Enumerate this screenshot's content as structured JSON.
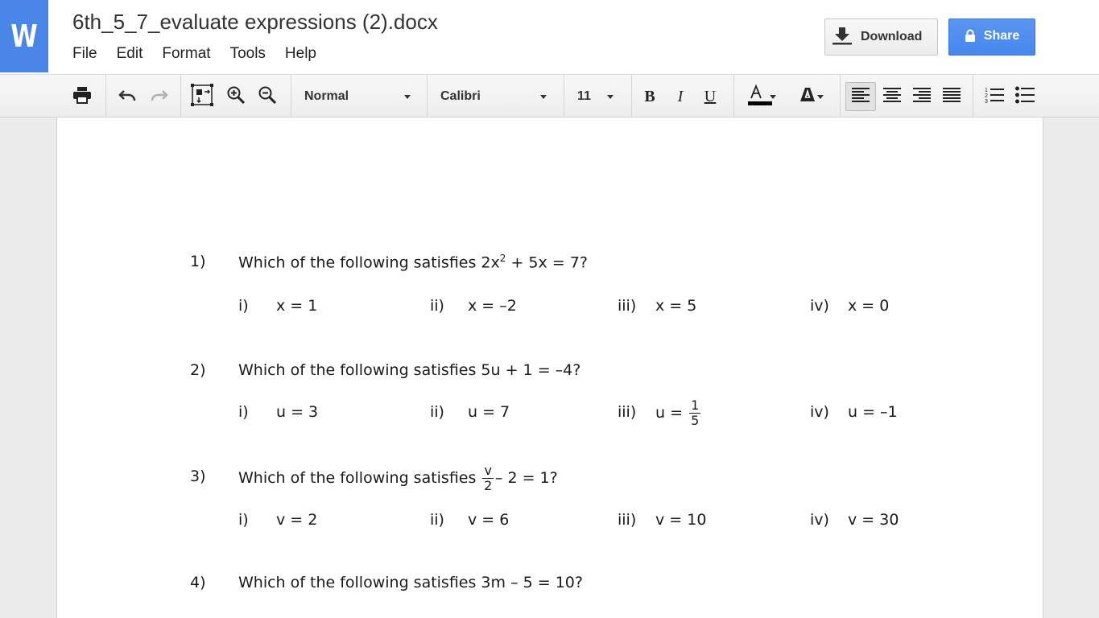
{
  "app": {
    "logo": "W",
    "title": "6th_5_7_evaluate expressions (2).docx"
  },
  "menu": [
    "File",
    "Edit",
    "Format",
    "Tools",
    "Help"
  ],
  "buttons": {
    "download": "Download",
    "share": "Share"
  },
  "toolbar": {
    "style": "Normal",
    "font": "Calibri",
    "size": "11"
  },
  "colors": {
    "brand": "#4a86e8",
    "share": "#4787ed"
  },
  "icons": [
    "print-icon",
    "undo-icon",
    "redo-icon",
    "fit-page-icon",
    "zoom-in-icon",
    "zoom-out-icon",
    "bold-icon",
    "italic-icon",
    "underline-icon",
    "text-color-icon",
    "highlight-icon",
    "align-left-icon",
    "align-center-icon",
    "align-right-icon",
    "justify-icon",
    "numbered-list-icon",
    "bulleted-list-icon",
    "download-icon",
    "lock-icon"
  ],
  "questions": [
    {
      "num": "1)",
      "text_prefix": "Which of the following satisfies 2x",
      "sup": "2",
      "text_suffix": " + 5x = 7?",
      "options": [
        {
          "label": "i)",
          "value": "x = 1"
        },
        {
          "label": "ii)",
          "value": "x = –2"
        },
        {
          "label": "iii)",
          "value": "x = 5"
        },
        {
          "label": "iv)",
          "value": "x = 0"
        }
      ]
    },
    {
      "num": "2)",
      "text": "Which of the following satisfies 5u + 1 = –4?",
      "options": [
        {
          "label": "i)",
          "value": "u = 3"
        },
        {
          "label": "ii)",
          "value": "u = 7"
        },
        {
          "label": "iii)",
          "value": "u =",
          "frac_num": "1",
          "frac_den": "5"
        },
        {
          "label": "iv)",
          "value": "u = –1"
        }
      ]
    },
    {
      "num": "3)",
      "text_prefix": "Which of the following satisfies",
      "frac_num": "v",
      "frac_den": "2",
      "text_suffix": "– 2 = 1?",
      "options": [
        {
          "label": "i)",
          "value": "v = 2"
        },
        {
          "label": "ii)",
          "value": "v = 6"
        },
        {
          "label": "iii)",
          "value": "v = 10"
        },
        {
          "label": "iv)",
          "value": "v = 30"
        }
      ]
    },
    {
      "num": "4)",
      "text": "Which of the following satisfies 3m – 5 = 10?"
    }
  ]
}
